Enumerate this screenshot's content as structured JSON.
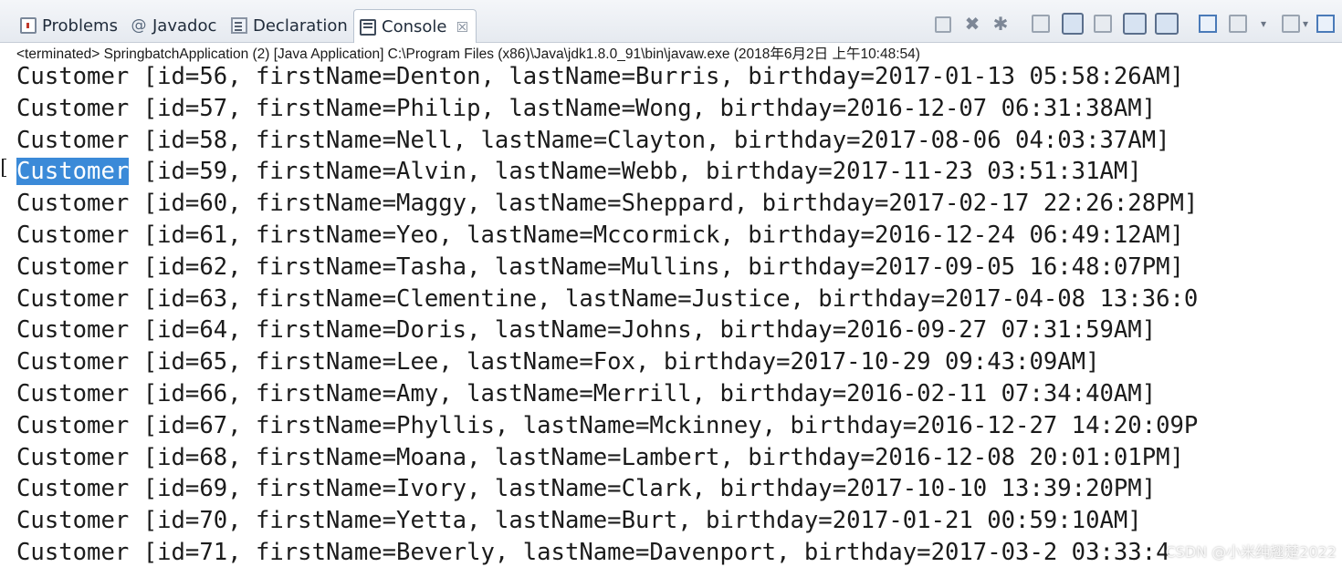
{
  "tabs": [
    {
      "label": "Problems",
      "icon": "problems-icon",
      "active": false
    },
    {
      "label": "Javadoc",
      "icon": "javadoc-icon",
      "active": false
    },
    {
      "label": "Declaration",
      "icon": "declaration-icon",
      "active": false
    },
    {
      "label": "Console",
      "icon": "console-icon",
      "active": true,
      "close_glyph": "☒"
    }
  ],
  "toolbar_icons": [
    "remove-launch-icon",
    "remove-all-terminated-icon",
    "clear-console-icon",
    "scroll-lock-icon",
    "word-wrap-icon",
    "show-on-output-icon",
    "pin-console-icon",
    "display-selected-console-icon",
    "open-console-icon",
    "view-menu-icon",
    "minimize-icon",
    "maximize-icon"
  ],
  "status_text": "<terminated> SpringbatchApplication (2) [Java Application] C:\\Program Files (x86)\\Java\\jdk1.8.0_91\\bin\\javaw.exe (2018年6月2日 上午10:48:54)",
  "console": {
    "selected_line_index": 3,
    "selection_color": "#3b8ad8",
    "lines": [
      {
        "cls": "Customer",
        "rest": " [id=56, firstName=Denton, lastName=Burris, birthday=2017-01-13 05:58:26AM]"
      },
      {
        "cls": "Customer",
        "rest": " [id=57, firstName=Philip, lastName=Wong, birthday=2016-12-07 06:31:38AM]"
      },
      {
        "cls": "Customer",
        "rest": " [id=58, firstName=Nell, lastName=Clayton, birthday=2017-08-06 04:03:37AM]"
      },
      {
        "cls": "Customer",
        "rest": " [id=59, firstName=Alvin, lastName=Webb, birthday=2017-11-23 03:51:31AM]"
      },
      {
        "cls": "Customer",
        "rest": " [id=60, firstName=Maggy, lastName=Sheppard, birthday=2017-02-17 22:26:28PM]"
      },
      {
        "cls": "Customer",
        "rest": " [id=61, firstName=Yeo, lastName=Mccormick, birthday=2016-12-24 06:49:12AM]"
      },
      {
        "cls": "Customer",
        "rest": " [id=62, firstName=Tasha, lastName=Mullins, birthday=2017-09-05 16:48:07PM]"
      },
      {
        "cls": "Customer",
        "rest": " [id=63, firstName=Clementine, lastName=Justice, birthday=2017-04-08 13:36:0"
      },
      {
        "cls": "Customer",
        "rest": " [id=64, firstName=Doris, lastName=Johns, birthday=2016-09-27 07:31:59AM]"
      },
      {
        "cls": "Customer",
        "rest": " [id=65, firstName=Lee, lastName=Fox, birthday=2017-10-29 09:43:09AM]"
      },
      {
        "cls": "Customer",
        "rest": " [id=66, firstName=Amy, lastName=Merrill, birthday=2016-02-11 07:34:40AM]"
      },
      {
        "cls": "Customer",
        "rest": " [id=67, firstName=Phyllis, lastName=Mckinney, birthday=2016-12-27 14:20:09P"
      },
      {
        "cls": "Customer",
        "rest": " [id=68, firstName=Moana, lastName=Lambert, birthday=2016-12-08 20:01:01PM]"
      },
      {
        "cls": "Customer",
        "rest": " [id=69, firstName=Ivory, lastName=Clark, birthday=2017-10-10 13:39:20PM]"
      },
      {
        "cls": "Customer",
        "rest": " [id=70, firstName=Yetta, lastName=Burt, birthday=2017-01-21 00:59:10AM]"
      },
      {
        "cls": "Customer",
        "rest": " [id=71, firstName=Beverly, lastName=Davenport, birthday=2017-03-2 03:33:4"
      }
    ]
  },
  "watermark": "CSDN @小米纯翘楚2022"
}
